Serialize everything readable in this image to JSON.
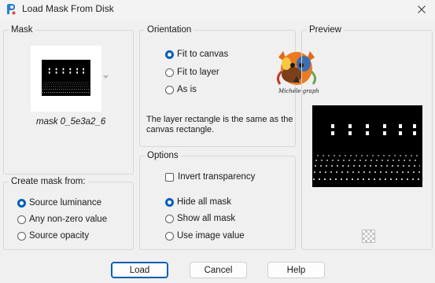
{
  "window": {
    "title": "Load Mask From Disk",
    "app_icon": "paint-shop-pro-icon",
    "close_icon": "close-icon"
  },
  "mask_group": {
    "legend": "Mask",
    "mask_name": "mask 0_5e3a2_6"
  },
  "create_group": {
    "legend": "Create mask from:",
    "options": [
      "Source luminance",
      "Any non-zero value",
      "Source opacity"
    ],
    "selected": "Source luminance"
  },
  "orientation_group": {
    "legend": "Orientation",
    "options": [
      "Fit to canvas",
      "Fit to layer",
      "As is"
    ],
    "selected": "Fit to canvas",
    "description": "The layer rectangle is the same as the canvas rectangle.",
    "watermark_text": "Michéle-graph"
  },
  "options_group": {
    "legend": "Options",
    "invert_label": "Invert transparency",
    "invert_checked": false,
    "show_options": [
      "Hide all mask",
      "Show all mask",
      "Use image value"
    ],
    "selected": "Hide all mask"
  },
  "preview_group": {
    "legend": "Preview",
    "transparency_icon": "checkerboard-icon"
  },
  "buttons": {
    "load": "Load",
    "cancel": "Cancel",
    "help": "Help"
  },
  "colors": {
    "accent": "#005fb8",
    "background": "#f0f0f0"
  }
}
